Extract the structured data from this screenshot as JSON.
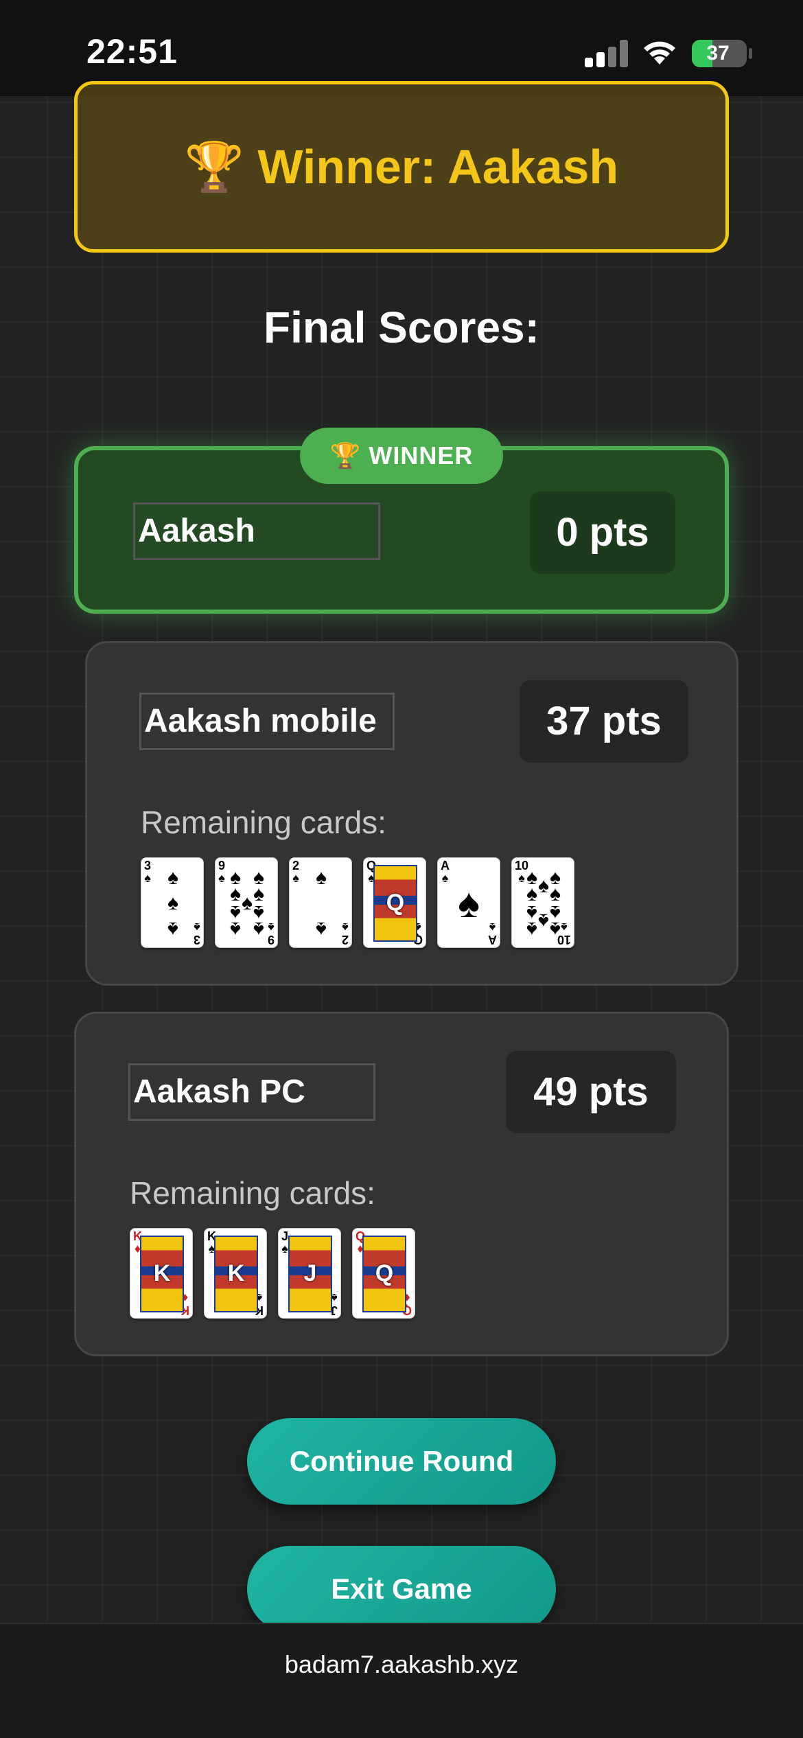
{
  "status_bar": {
    "time": "22:51",
    "battery": "37",
    "battery_level": 0.37
  },
  "winner_banner": {
    "icon": "🏆",
    "text": "Winner: Aakash"
  },
  "final_scores_title": "Final Scores:",
  "winner_badge": {
    "icon": "🏆",
    "label": "WINNER"
  },
  "players": [
    {
      "name": "Aakash",
      "points": "0 pts",
      "is_winner": true
    },
    {
      "name": "Aakash mobile",
      "points": "37 pts",
      "remaining_label": "Remaining cards:",
      "cards": [
        {
          "rank": "3",
          "suit": "♠",
          "color": "black"
        },
        {
          "rank": "9",
          "suit": "♠",
          "color": "black"
        },
        {
          "rank": "2",
          "suit": "♠",
          "color": "black"
        },
        {
          "rank": "Q",
          "suit": "♠",
          "color": "black"
        },
        {
          "rank": "A",
          "suit": "♠",
          "color": "black"
        },
        {
          "rank": "10",
          "suit": "♠",
          "color": "black"
        }
      ]
    },
    {
      "name": "Aakash PC",
      "points": "49 pts",
      "remaining_label": "Remaining cards:",
      "cards": [
        {
          "rank": "K",
          "suit": "♦",
          "color": "red"
        },
        {
          "rank": "K",
          "suit": "♠",
          "color": "black"
        },
        {
          "rank": "J",
          "suit": "♠",
          "color": "black"
        },
        {
          "rank": "Q",
          "suit": "♦",
          "color": "red"
        }
      ]
    }
  ],
  "buttons": {
    "continue": "Continue Round",
    "exit": "Exit Game"
  },
  "footer": {
    "url": "badam7.aakashb.xyz"
  },
  "colors": {
    "accent": "#1fb5a2",
    "winner_green": "#4caf50",
    "gold": "#f5c518"
  }
}
